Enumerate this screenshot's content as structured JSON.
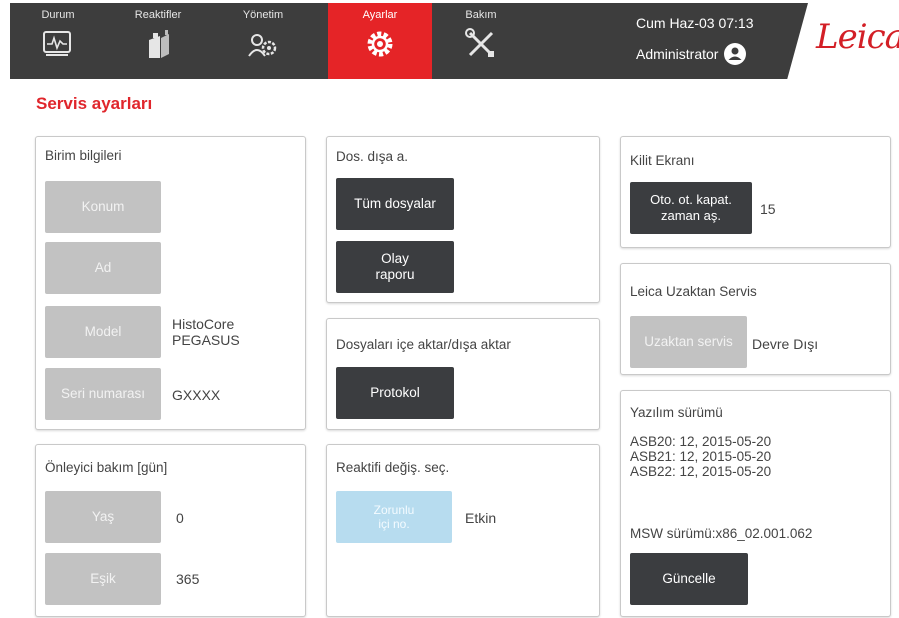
{
  "nav": {
    "tabs": [
      {
        "label": "Durum",
        "icon": "status-monitor-icon"
      },
      {
        "label": "Reaktifler",
        "icon": "reagent-bottles-icon"
      },
      {
        "label": "Yönetim",
        "icon": "admin-gear-people-icon"
      },
      {
        "label": "Ayarlar",
        "icon": "settings-gear-icon",
        "active": true
      },
      {
        "label": "Bakım",
        "icon": "maintenance-tools-icon"
      }
    ],
    "datetime": "Cum Haz-03 07:13",
    "user": "Administrator",
    "logo": "Leica"
  },
  "page": {
    "title": "Servis ayarları"
  },
  "unit_info": {
    "title": "Birim bilgileri",
    "location_label": "Konum",
    "name_label": "Ad",
    "model_label": "Model",
    "model_value_line1": "HistoCore",
    "model_value_line2": "PEGASUS",
    "serial_label": "Seri numarası",
    "serial_value": "GXXXX"
  },
  "preventive": {
    "title": "Önleyici bakım [gün]",
    "age_label": "Yaş",
    "age_value": "0",
    "threshold_label": "Eşik",
    "threshold_value": "365"
  },
  "file_export": {
    "title": "Dos. dışa a.",
    "all_files_label": "Tüm dosyalar",
    "event_report_line1": "Olay",
    "event_report_line2": "raporu"
  },
  "import_export": {
    "title": "Dosyaları içe aktar/dışa aktar",
    "protocol_label": "Protokol"
  },
  "reagent_change": {
    "title": "Reaktifi değiş. seç.",
    "force_line1": "Zorunlu",
    "force_line2": "içi no.",
    "status": "Etkin"
  },
  "lock_screen": {
    "title": "Kilit Ekranı",
    "timeout_line1": "Oto. ot. kapat.",
    "timeout_line2": "zaman aş.",
    "timeout_value": "15"
  },
  "remote_service": {
    "title": "Leica Uzaktan Servis",
    "button_label": "Uzaktan servis",
    "status": "Devre Dışı"
  },
  "software": {
    "title": "Yazılım sürümü",
    "asb20": "ASB20: 12, 2015-05-20",
    "asb21": "ASB21: 12, 2015-05-20",
    "asb22": "ASB22: 12, 2015-05-20",
    "msw": "MSW sürümü:x86_02.001.062",
    "update_label": "Güncelle"
  },
  "colors": {
    "accent": "#e52427",
    "topbar": "#3d3d3d",
    "button_dark": "#3b3d40",
    "button_disabled": "#c2c2c2",
    "button_light": "#b7dcef"
  }
}
